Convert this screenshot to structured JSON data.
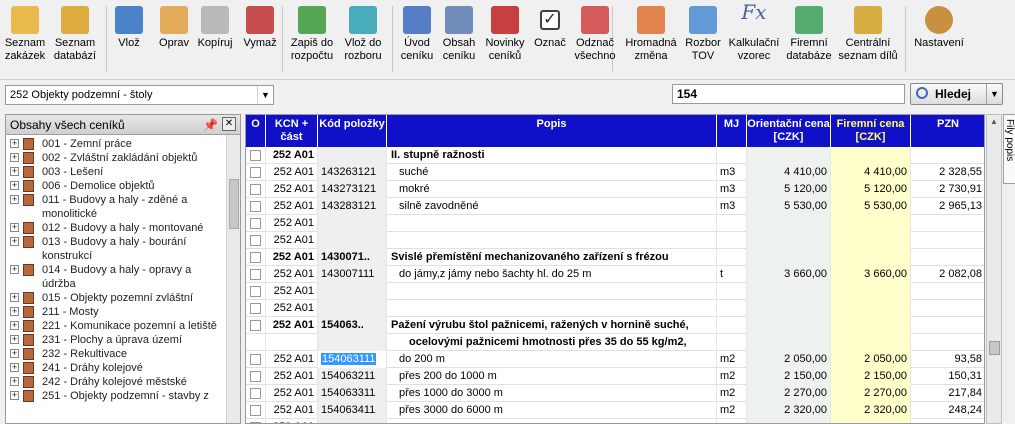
{
  "toolbar": {
    "buttons": [
      {
        "label1": "Seznam",
        "label2": "zakázek",
        "icon": "folder-z-icon"
      },
      {
        "label1": "Seznam",
        "label2": "databází",
        "icon": "folder-d-icon"
      },
      {
        "label1": "Vlož",
        "label2": "",
        "icon": "insert-arrow-icon"
      },
      {
        "label1": "Oprav",
        "label2": "",
        "icon": "pencil-edit-icon"
      },
      {
        "label1": "Kopíruj",
        "label2": "",
        "icon": "copy-pages-icon"
      },
      {
        "label1": "Vymaž",
        "label2": "",
        "icon": "delete-arrow-icon"
      },
      {
        "label1": "Zapiš do",
        "label2": "rozpočtu",
        "icon": "write-to-budget-icon"
      },
      {
        "label1": "Vlož do",
        "label2": "rozboru",
        "icon": "insert-to-analysis-icon"
      },
      {
        "label1": "Úvod",
        "label2": "ceníku",
        "icon": "pricelist-intro-icon"
      },
      {
        "label1": "Obsah",
        "label2": "ceníku",
        "icon": "pricelist-content-icon"
      },
      {
        "label1": "Novinky",
        "label2": "ceníků",
        "icon": "news-icon"
      },
      {
        "label1": "Označ",
        "label2": "",
        "icon": "checkbox-checked-icon"
      },
      {
        "label1": "Odznač",
        "label2": "všechno",
        "icon": "uncheck-all-icon"
      },
      {
        "label1": "Hromadná",
        "label2": "změna",
        "icon": "bulk-change-icon"
      },
      {
        "label1": "Rozbor",
        "label2": "TOV",
        "icon": "tov-analysis-icon"
      },
      {
        "label1": "Kalkulační",
        "label2": "vzorec",
        "icon": "formula-fx-icon"
      },
      {
        "label1": "Firemní",
        "label2": "databáze",
        "icon": "company-database-icon"
      },
      {
        "label1": "Centrální",
        "label2": "seznam dílů",
        "icon": "central-parts-list-icon"
      },
      {
        "label1": "Nastavení",
        "label2": "",
        "icon": "settings-gear-icon"
      }
    ]
  },
  "selector": {
    "value": "252  Objekty podzemní - štoly"
  },
  "search": {
    "value": "154",
    "button_label": "Hledej"
  },
  "left_panel": {
    "title": "Obsahy všech ceníků",
    "items": [
      "001 - Zemní práce",
      "002 - Zvláštní zakládání objektů",
      "003 - Lešení",
      "006 - Demolice objektů",
      "011 - Budovy a haly - zděné a monolitické",
      "012 - Budovy a haly - montované",
      "013 - Budovy a haly - bourání konstrukcí",
      "014 - Budovy a haly - opravy a údržba",
      "015 - Objekty pozemní zvláštní",
      "211 - Mosty",
      "221 - Komunikace pozemní a letiště",
      "231 - Plochy a úprava území",
      "232 - Rekultivace",
      "241 - Dráhy kolejové",
      "242 - Dráhy kolejové městské",
      "251 - Objekty podzemní - stavby z"
    ]
  },
  "grid": {
    "headers": [
      "O",
      "KCN + část",
      "Kód položky",
      "Popis",
      "MJ",
      "Orientační cena [CZK]",
      "Firemní cena [CZK]",
      "PZN"
    ],
    "rows": [
      {
        "kcn": "252 A01",
        "code": "",
        "desc": "II. stupně ražnosti",
        "mj": "",
        "orient": "",
        "firm": "",
        "pzn": "",
        "bold": true
      },
      {
        "kcn": "252 A01",
        "code": "143263121",
        "desc": "suché",
        "mj": "m3",
        "orient": "4 410,00",
        "firm": "4 410,00",
        "pzn": "2 328,55",
        "bold": false
      },
      {
        "kcn": "252 A01",
        "code": "143273121",
        "desc": "mokré",
        "mj": "m3",
        "orient": "5 120,00",
        "firm": "5 120,00",
        "pzn": "2 730,91",
        "bold": false
      },
      {
        "kcn": "252 A01",
        "code": "143283121",
        "desc": "silně zavodněné",
        "mj": "m3",
        "orient": "5 530,00",
        "firm": "5 530,00",
        "pzn": "2 965,13",
        "bold": false
      },
      {
        "kcn": "252 A01",
        "code": "",
        "desc": "",
        "mj": "",
        "orient": "",
        "firm": "",
        "pzn": "",
        "bold": false
      },
      {
        "kcn": "252 A01",
        "code": "",
        "desc": "",
        "mj": "",
        "orient": "",
        "firm": "",
        "pzn": "",
        "bold": false
      },
      {
        "kcn": "252 A01",
        "code": "1430071..",
        "desc": "Svislé přemístění mechanizovaného zařízení s frézou",
        "mj": "",
        "orient": "",
        "firm": "",
        "pzn": "",
        "bold": true
      },
      {
        "kcn": "252 A01",
        "code": "143007111",
        "desc": "do jámy,z jámy nebo šachty hl. do 25 m",
        "mj": "t",
        "orient": "3 660,00",
        "firm": "3 660,00",
        "pzn": "2 082,08",
        "bold": false
      },
      {
        "kcn": "252 A01",
        "code": "",
        "desc": "",
        "mj": "",
        "orient": "",
        "firm": "",
        "pzn": "",
        "bold": false
      },
      {
        "kcn": "252 A01",
        "code": "",
        "desc": "",
        "mj": "",
        "orient": "",
        "firm": "",
        "pzn": "",
        "bold": false
      },
      {
        "kcn": "252 A01",
        "code": "154063..",
        "desc": "Pažení výrubu štol pažnicemi, ražených v hornině suché,",
        "mj": "",
        "orient": "",
        "firm": "",
        "pzn": "",
        "bold": true
      },
      {
        "kcn": "",
        "code": "",
        "desc": "ocelovými pažnicemi hmotnosti přes 35 do 55 kg/m2,",
        "mj": "",
        "orient": "",
        "firm": "",
        "pzn": "",
        "bold": true
      },
      {
        "kcn": "252 A01",
        "code": "154063111",
        "desc": "do 200 m",
        "mj": "m2",
        "orient": "2 050,00",
        "firm": "2 050,00",
        "pzn": "93,58",
        "bold": false
      },
      {
        "kcn": "252 A01",
        "code": "154063211",
        "desc": "přes 200 do 1000 m",
        "mj": "m2",
        "orient": "2 150,00",
        "firm": "2 150,00",
        "pzn": "150,31",
        "bold": false
      },
      {
        "kcn": "252 A01",
        "code": "154063311",
        "desc": "přes 1000 do 3000 m",
        "mj": "m2",
        "orient": "2 270,00",
        "firm": "2 270,00",
        "pzn": "217,84",
        "bold": false
      },
      {
        "kcn": "252 A01",
        "code": "154063411",
        "desc": "přes 3000 do 6000 m",
        "mj": "m2",
        "orient": "2 320,00",
        "firm": "2 320,00",
        "pzn": "248,24",
        "bold": false
      },
      {
        "kcn": "252 A01",
        "code": "",
        "desc": "",
        "mj": "",
        "orient": "",
        "firm": "",
        "pzn": "",
        "bold": true
      }
    ]
  },
  "side_tab": {
    "label": "Fily popis"
  }
}
